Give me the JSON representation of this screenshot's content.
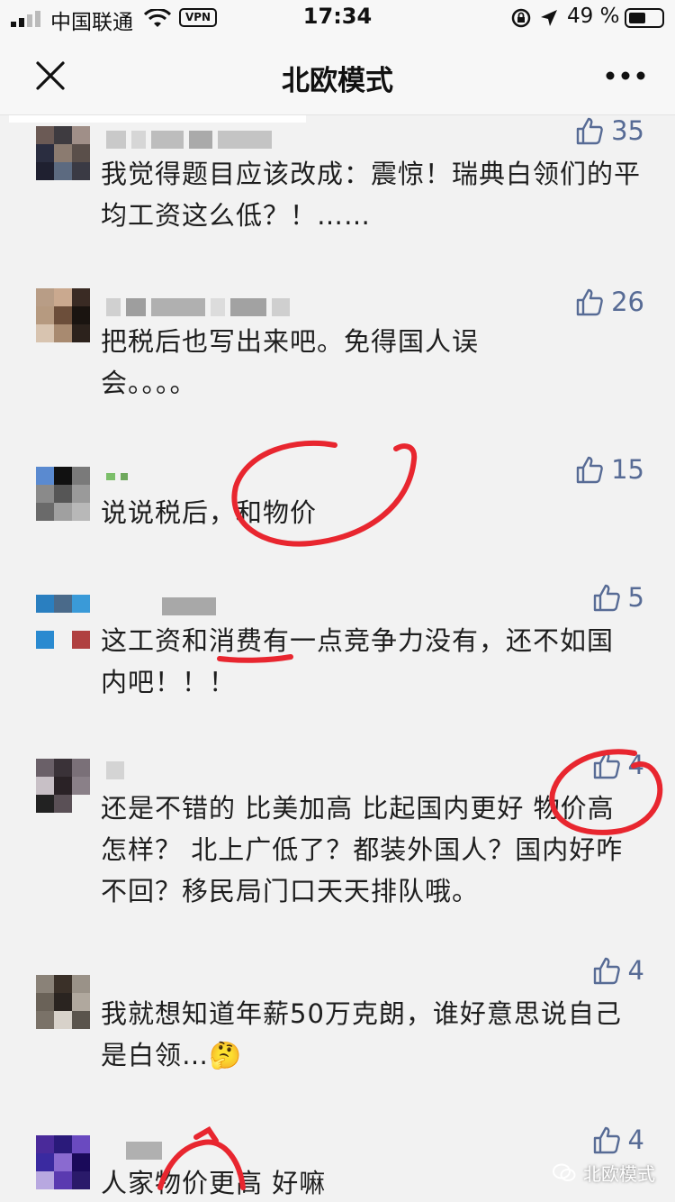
{
  "status_bar": {
    "carrier": "中国联通",
    "vpn": "VPN",
    "time": "17:34",
    "battery": "49 %"
  },
  "nav": {
    "title": "北欧模式"
  },
  "comments": [
    {
      "text": "我觉得题目应该改成：震惊！瑞典白领们的平均工资这么低？！……",
      "likes": "35"
    },
    {
      "text": "把税后也写出来吧。免得国人误会。。。。",
      "likes": "26"
    },
    {
      "text": "说说税后，和物价",
      "likes": "15"
    },
    {
      "text": "这工资和消费有一点竞争力没有，还不如国内吧！！！",
      "likes": "5"
    },
    {
      "text": "还是不错的 比美加高 比起国内更好 物价高怎样？ 北上广低了？都装外国人？国内好咋不回？移民局门口天天排队哦。",
      "likes": "4"
    },
    {
      "text": "我就想知道年薪50万克朗，谁好意思说自己是白领…🤔",
      "likes": "4"
    },
    {
      "text": "人家物价更高 好嘛",
      "likes": "4"
    }
  ],
  "watermark": "北欧模式",
  "colors": {
    "background": "#f2f2f2",
    "like_blue": "#576b95",
    "annotation_red": "#e8262f"
  }
}
